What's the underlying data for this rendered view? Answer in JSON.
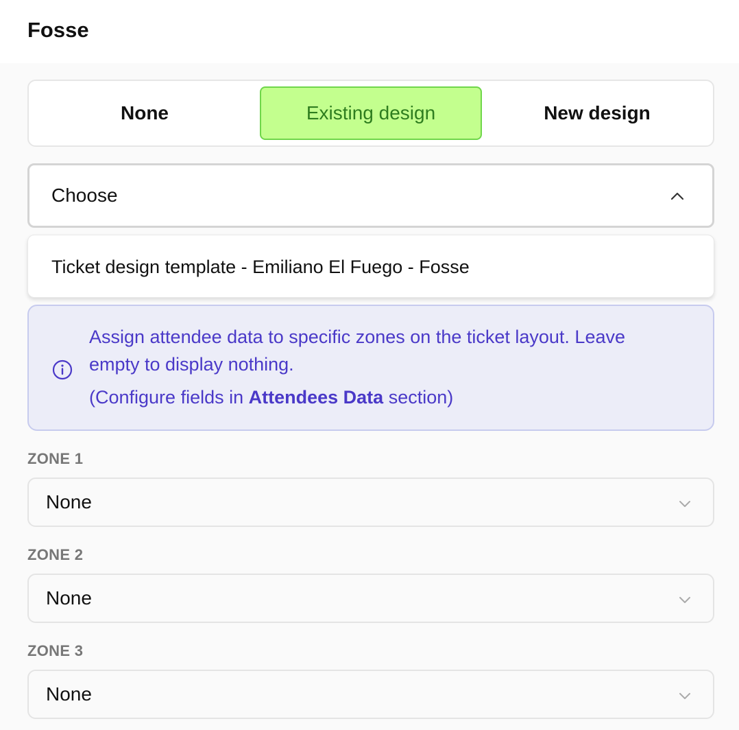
{
  "header": {
    "title": "Fosse"
  },
  "design_mode": {
    "options": [
      {
        "label": "None"
      },
      {
        "label": "Existing design"
      },
      {
        "label": "New design"
      }
    ],
    "selected": "Existing design",
    "selected_color": "#c3ff8e"
  },
  "template_select": {
    "value": "Choose",
    "options": [
      "Ticket design template - Emiliano El Fuego - Fosse"
    ]
  },
  "info": {
    "line1": "Assign attendee data to specific zones on the ticket layout. Leave",
    "line2": "empty to display nothing.",
    "line3_prefix": "(Configure fields in ",
    "line3_link": "Attendees Data",
    "line3_suffix": " section)",
    "color": "#4a39c8"
  },
  "zones": [
    {
      "label": "ZONE 1",
      "value": "None"
    },
    {
      "label": "ZONE 2",
      "value": "None"
    },
    {
      "label": "ZONE 3",
      "value": "None"
    }
  ],
  "icons": {
    "info": "info-circle-icon",
    "chevron_up": "chevron-up-icon",
    "chevron_down": "chevron-down-icon"
  }
}
